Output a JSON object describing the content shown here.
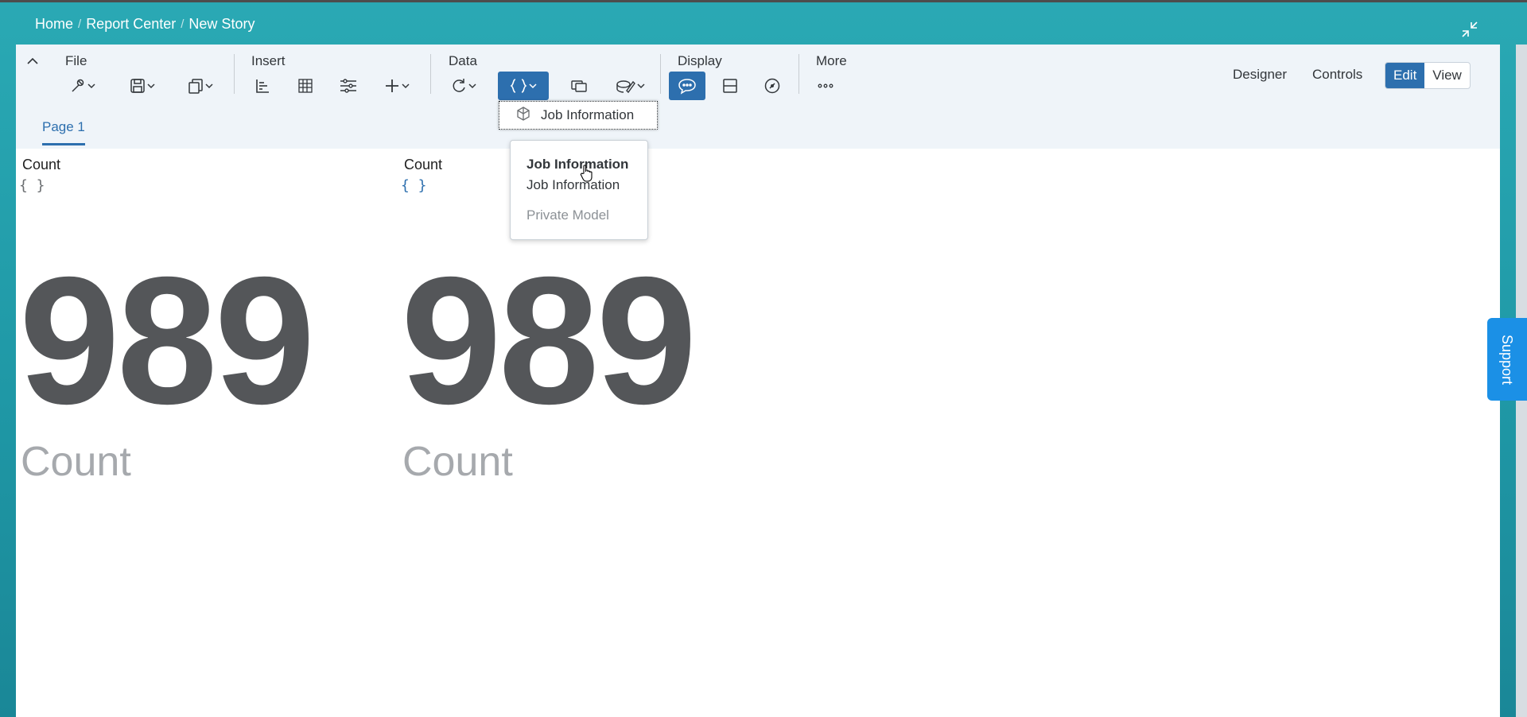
{
  "breadcrumb": {
    "home": "Home",
    "report_center": "Report Center",
    "new_story": "New Story"
  },
  "icons": {
    "exit_fullscreen": "exit-fullscreen-icon",
    "collapse": "chevron-up-icon",
    "tools": "wrench-icon",
    "save": "save-icon",
    "copy": "copy-icon",
    "chart": "bar-chart-icon",
    "table": "table-icon",
    "filter": "input-control-icon",
    "add": "plus-icon",
    "refresh": "refresh-icon",
    "formula": "formula-braces-icon",
    "linked": "linked-analysis-icon",
    "edit_data": "edit-prompts-icon",
    "comment": "comment-icon",
    "layout": "layout-icon",
    "performance": "performance-icon",
    "more": "more-ellipsis-icon",
    "model": "model-icon"
  },
  "toolbar": {
    "file_label": "File",
    "insert_label": "Insert",
    "data_label": "Data",
    "display_label": "Display",
    "more_label": "More",
    "designer_label": "Designer",
    "controls_label": "Controls",
    "edit_label": "Edit",
    "view_label": "View"
  },
  "page_tab": "Page 1",
  "dropdown": {
    "item_label": "Job Information"
  },
  "popover": {
    "title": "Job Information",
    "subtitle": "Job Information",
    "meta": "Private Model"
  },
  "tiles": [
    {
      "title": "Count",
      "formula": "{ }",
      "value": "989",
      "label": "Count"
    },
    {
      "title": "Count",
      "formula": "{ }",
      "value": "989",
      "label": "Count"
    }
  ],
  "support_label": "Support",
  "colors": {
    "accent": "#2d6fae",
    "teal_background": "#2aa9b4",
    "support": "#1b90e6",
    "formula_gray": "#6a6d70",
    "formula_blue": "#2d6fae"
  }
}
